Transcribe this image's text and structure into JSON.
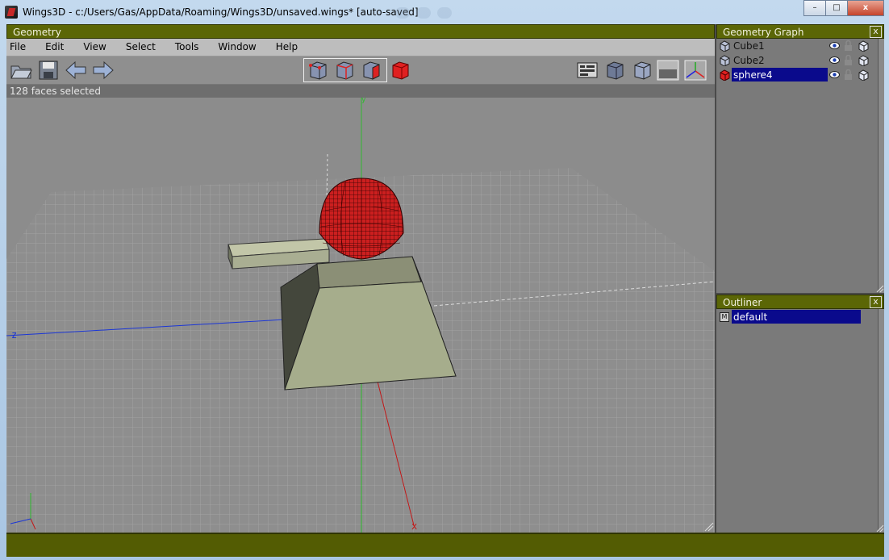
{
  "window": {
    "title": "Wings3D - c:/Users/Gas/AppData/Roaming/Wings3D/unsaved.wings* [auto-saved]",
    "minimize_label": "–",
    "maximize_label": "□",
    "close_label": "x"
  },
  "geometry": {
    "panel_title": "Geometry",
    "menu": [
      "File",
      "Edit",
      "View",
      "Select",
      "Tools",
      "Window",
      "Help"
    ],
    "status_text": "128 faces selected",
    "axis_x_label": "x",
    "axis_y_label": "y",
    "axis_z_label": "z"
  },
  "geometry_graph": {
    "panel_title": "Geometry Graph",
    "close_label": "x",
    "objects": [
      {
        "label": "Cube1",
        "selected": false
      },
      {
        "label": "Cube2",
        "selected": false
      },
      {
        "label": "sphere4",
        "selected": true
      }
    ]
  },
  "outliner": {
    "panel_title": "Outliner",
    "close_label": "x",
    "items": [
      {
        "badge": "M",
        "label": "default",
        "selected": true
      }
    ]
  },
  "colors": {
    "panel_header": "#5b6606",
    "selection": "#0a0a8c",
    "selected_faces": "#cc1f1f",
    "grid": "#9c9c9c",
    "mesh": "#a6ad8c"
  }
}
